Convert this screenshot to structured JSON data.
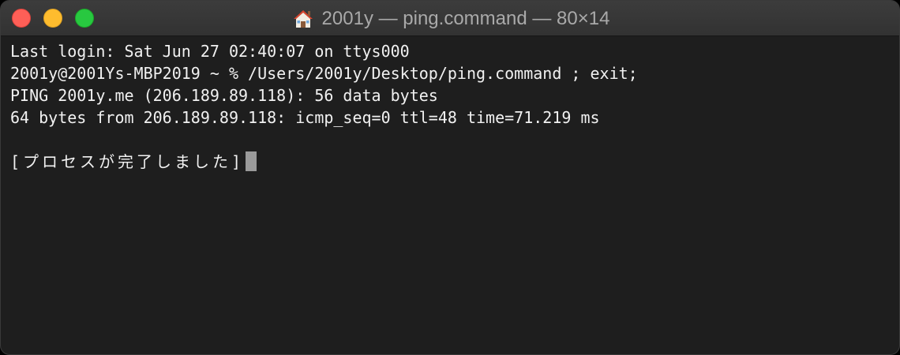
{
  "window": {
    "title": "2001y — ping.command — 80×14",
    "title_icon": "house-icon",
    "background": "#1e1e1e",
    "text_color": "#f1f1f1"
  },
  "terminal": {
    "lines": [
      "Last login: Sat Jun 27 02:40:07 on ttys000",
      "2001y@2001Ys-MBP2019 ~ % /Users/2001y/Desktop/ping.command ; exit;",
      "PING 2001y.me (206.189.89.118): 56 data bytes",
      "64 bytes from 206.189.89.118: icmp_seq=0 ttl=48 time=71.219 ms",
      "",
      "[プロセスが完了しました]"
    ]
  }
}
